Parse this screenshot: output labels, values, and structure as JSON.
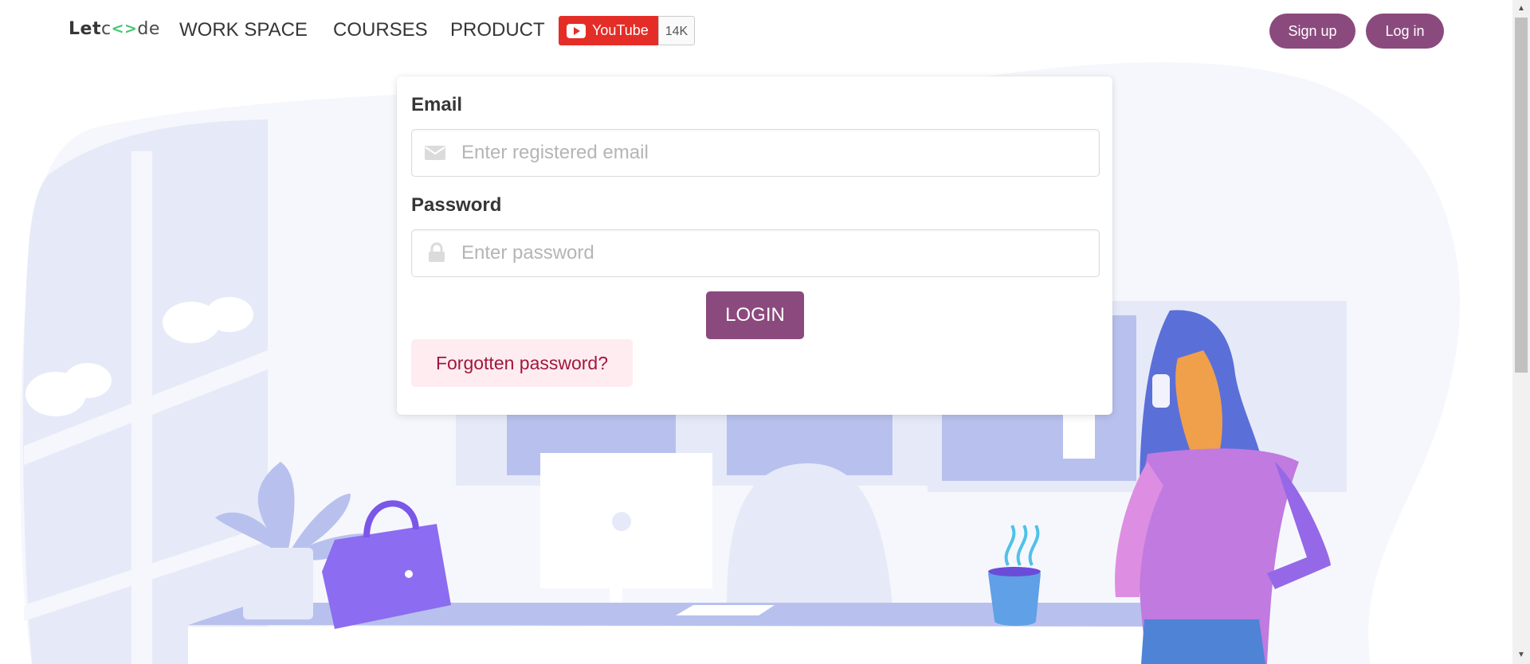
{
  "brand": {
    "logo_prefix": "Let",
    "logo_mid": "<>",
    "logo_suffix": "de"
  },
  "nav": {
    "workspace": "WORK SPACE",
    "courses": "COURSES",
    "product": "PRODUCT"
  },
  "youtube": {
    "label": "YouTube",
    "count": "14K"
  },
  "auth": {
    "signup": "Sign up",
    "login": "Log in"
  },
  "form": {
    "email_label": "Email",
    "email_placeholder": "Enter registered email",
    "email_value": "",
    "password_label": "Password",
    "password_placeholder": "Enter password",
    "password_value": "",
    "login_button": "LOGIN",
    "forgot_link": "Forgotten password?"
  },
  "colors": {
    "accent": "#8b4a7d",
    "youtube_red": "#e52d27",
    "forgot_bg": "#feecf0",
    "illustration_bg": "#f6f7fc",
    "illustration_mid": "#e6eaf8"
  },
  "icons": [
    "envelope-icon",
    "lock-icon",
    "youtube-play-icon"
  ]
}
